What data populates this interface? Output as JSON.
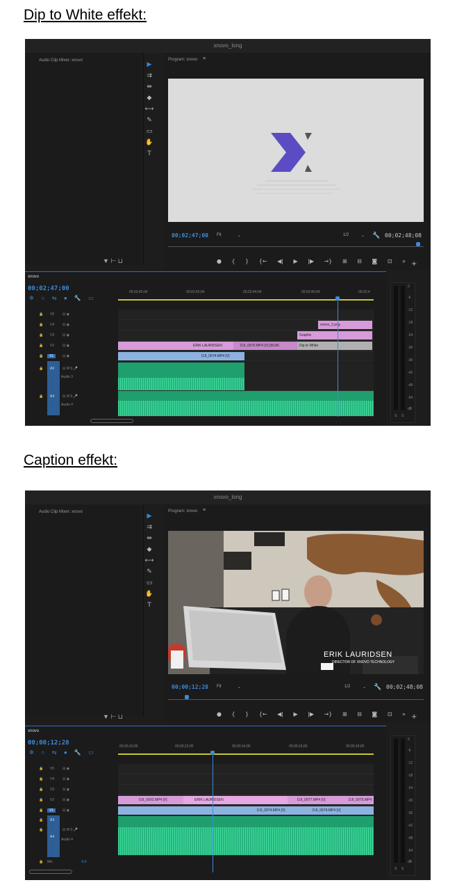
{
  "section1": {
    "heading": "Dip to White effekt:",
    "window_title": "xnovo_long",
    "audio_mixer_label": "Audio Clip Mixer: xnovo",
    "program_label": "Program: xnovo",
    "timecode_current": "00;02;47;00",
    "fit_label": "Fit",
    "resolution": "1/2",
    "timecode_end": "00;02;48;08",
    "sequence_tab": "xnovo",
    "sequence_timecode": "00;02;47;00",
    "ruler_ticks": [
      "00;02;40;04",
      "00;02;42;04",
      "00;02;44;04",
      "00;02;46;04",
      "00;02;4"
    ],
    "video_tracks": [
      "V5",
      "V4",
      "V3",
      "V2",
      "V1"
    ],
    "audio_tracks": [
      {
        "id": "A3",
        "name": "Audio 3"
      },
      {
        "id": "A4",
        "name": "Audio 4"
      }
    ],
    "clips": {
      "v4": "xnovo_2.png",
      "v3": "Graphic",
      "v2_a": "ERIK LAURIDSEN",
      "v2_b": "DJI_0970.MP4 [V] [69.86",
      "v2_c": "Dip to White",
      "v1": "DJI_0974.MP4 [V]"
    },
    "meter_scale": [
      "0",
      "-6",
      "-12",
      "-18",
      "-24",
      "-30",
      "-36",
      "-42",
      "-48",
      "-54",
      "dB"
    ],
    "meter_bottom": [
      "S",
      "S"
    ]
  },
  "section2": {
    "heading": "Caption effekt:",
    "window_title": "xnovo_long",
    "audio_mixer_label": "Audio Clip Mixer: xnovo",
    "program_label": "Program: xnovo",
    "caption_name": "ERIK LAURIDSEN",
    "caption_title": "DIRECTOR OF XNOVO TECHNOLOGY",
    "timecode_current": "00;00;12;28",
    "fit_label": "Fit",
    "resolution": "1/2",
    "timecode_end": "00;02;48;08",
    "sequence_tab": "xnovo",
    "sequence_timecode": "00;00;12;28",
    "ruler_ticks": [
      "00;00;10;00",
      "00;00;12;00",
      "00;00;14;00",
      "00;00;16;00",
      "00;00;18;00"
    ],
    "video_tracks": [
      "V5",
      "V4",
      "V3",
      "V2",
      "V1"
    ],
    "audio_tracks": [
      {
        "id": "A3",
        "name": ""
      },
      {
        "id": "A4",
        "name": "Audio 4"
      }
    ],
    "mix_label": "Mix",
    "mix_value": "-3,4",
    "clips": {
      "v2_a": "DJI_0992.MP4 [V]",
      "v2_b": "ERIK LAURIDSEN",
      "v2_c": "DJI_0977.MP4 [V]",
      "v2_d": "DJI_0975.MP4",
      "v1_a": "DJI_0974.MP4 [V]",
      "v1_b": "DJI_0974.MP4 [V]"
    },
    "meter_scale": [
      "0",
      "-6",
      "-12",
      "-18",
      "-24",
      "-30",
      "-36",
      "-42",
      "-48",
      "-54",
      "dB"
    ],
    "meter_bottom": [
      "S",
      "S"
    ]
  },
  "colors": {
    "accent_blue": "#3d8bd9",
    "clip_pink": "#d79bd9",
    "clip_blue": "#8cb2e0",
    "audio_green": "#1f9e6e",
    "logo_purple": "#5b4cc4"
  }
}
